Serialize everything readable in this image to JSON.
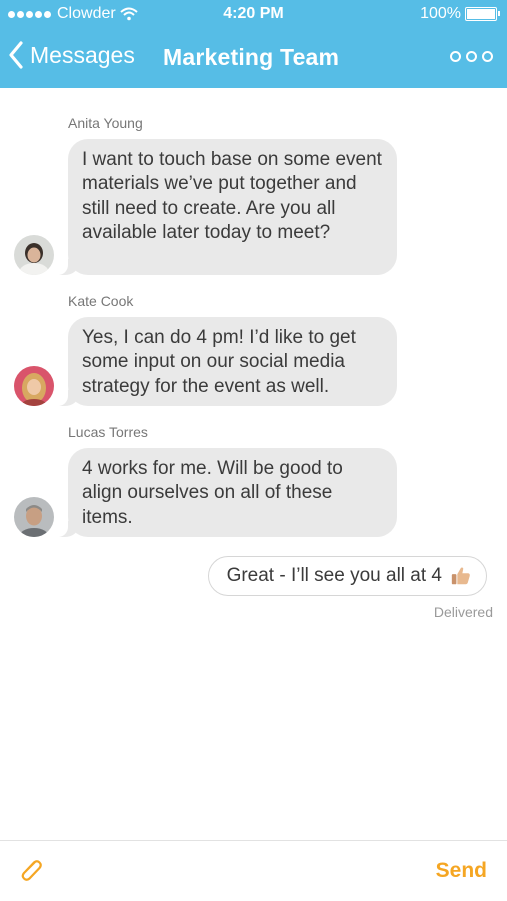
{
  "status_bar": {
    "carrier": "Clowder",
    "time": "4:20 PM",
    "battery": "100%"
  },
  "nav": {
    "back_label": "Messages",
    "title": "Marketing Team",
    "icons": [
      "chevron-left-icon",
      "more-icon"
    ]
  },
  "messages": [
    {
      "sender": "Anita Young",
      "text": "I want to touch base on some event materials we’ve put together and still need to create. Are you all available later today to meet?"
    },
    {
      "sender": "Kate Cook",
      "text": "Yes, I can do 4 pm! I’d like to get some input on our social media strategy for the event as well."
    },
    {
      "sender": "Lucas Torres",
      "text": "4 works for me. Will be good to align ourselves on all of these items."
    }
  ],
  "my_message": {
    "text": "Great - I’ll see you all at 4",
    "emoji_icon": "thumbs-up-icon",
    "status": "Delivered"
  },
  "composer": {
    "attach_icon": "paperclip-icon",
    "send_label": "Send",
    "accent_color": "#f5a623"
  },
  "colors": {
    "header": "#56bde6",
    "bubble": "#e9e9e9"
  }
}
